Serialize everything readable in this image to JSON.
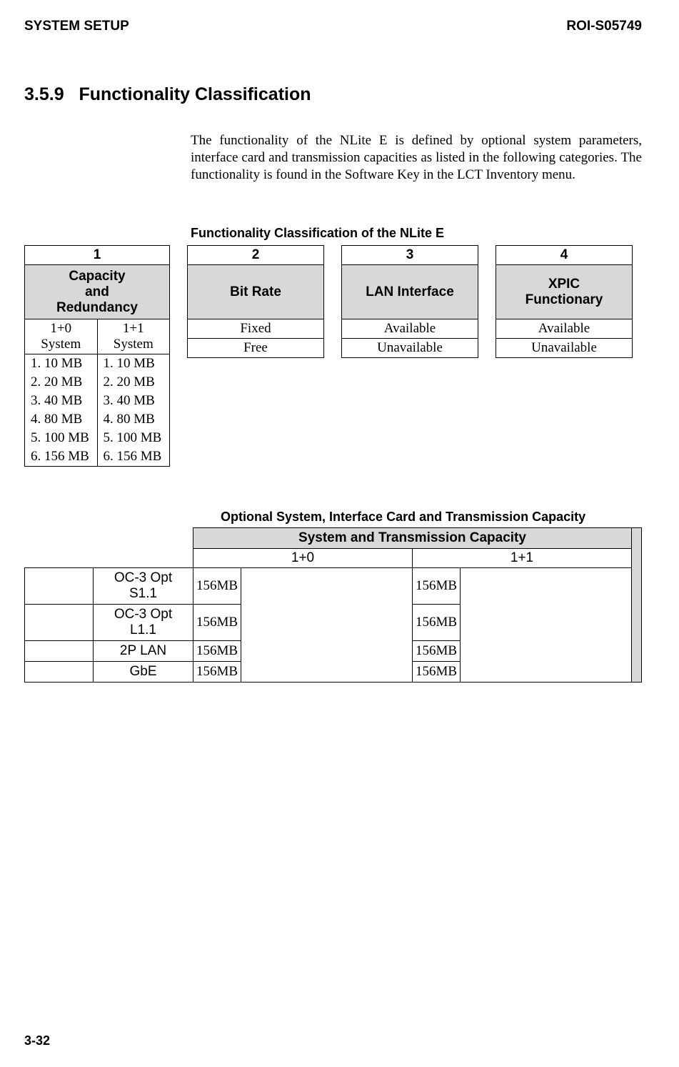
{
  "header": {
    "left": "SYSTEM SETUP",
    "right": "ROI-S05749"
  },
  "section": {
    "number": "3.5.9",
    "title": "Functionality Classification"
  },
  "paragraph": "The functionality of the NLite E is defined by optional system parameters, interface card and transmission capacities as listed in the following categories. The functionality is found in the Software Key in the LCT Inventory menu.",
  "fc_title": "Functionality Classification of the NLite E",
  "fc": {
    "box1": {
      "num": "1",
      "label": "Capacity\nand\nRedundancy",
      "subheads": [
        "1+0 System",
        "1+1 System"
      ],
      "rows": [
        [
          "1. 10 MB",
          "1. 10 MB"
        ],
        [
          "2. 20 MB",
          "2. 20 MB"
        ],
        [
          "3. 40 MB",
          "3. 40 MB"
        ],
        [
          "4. 80 MB",
          "4. 80 MB"
        ],
        [
          "5. 100 MB",
          "5. 100 MB"
        ],
        [
          "6. 156 MB",
          "6. 156 MB"
        ]
      ]
    },
    "box2": {
      "num": "2",
      "label": "Bit Rate",
      "rows": [
        "Fixed",
        "Free"
      ]
    },
    "box3": {
      "num": "3",
      "label": "LAN Interface",
      "rows": [
        "Available",
        "Unavailable"
      ]
    },
    "box4": {
      "num": "4",
      "label": "XPIC\nFunctionary",
      "rows": [
        "Available",
        "Unavailable"
      ]
    }
  },
  "ot_title": "Optional System, Interface Card and Transmission Capacity",
  "ot": {
    "head": "System and Transmission Capacity",
    "subs": [
      "1+0",
      "1+1"
    ],
    "rows": [
      {
        "label": "OC-3 Opt S1.1",
        "v0": "156MB",
        "v1": "156MB"
      },
      {
        "label": "OC-3 Opt L1.1",
        "v0": "156MB",
        "v1": "156MB"
      },
      {
        "label": "2P LAN",
        "v0": "156MB",
        "v1": "156MB"
      },
      {
        "label": "GbE",
        "v0": "156MB",
        "v1": "156MB"
      }
    ]
  },
  "footer": "3-32"
}
